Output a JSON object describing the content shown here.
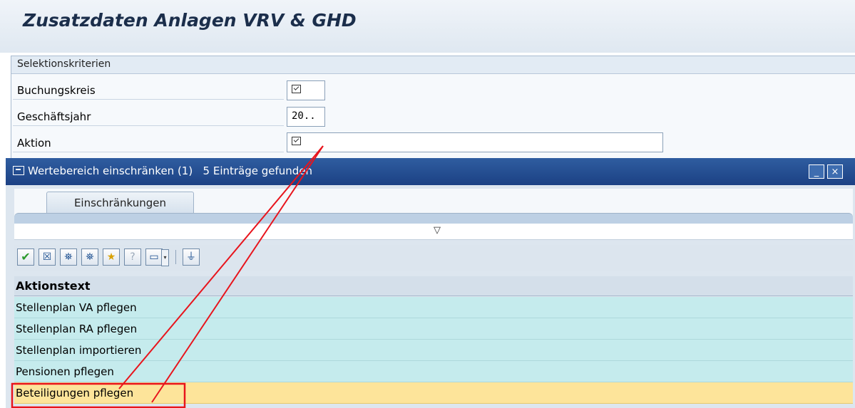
{
  "screen": {
    "title": "Zusatzdaten Anlagen VRV & GHD"
  },
  "selection": {
    "frame_title": "Selektionskriterien",
    "fields": [
      {
        "label": "Buchungskreis",
        "value": ""
      },
      {
        "label": "Geschäftsjahr",
        "value": "20.."
      },
      {
        "label": "Aktion",
        "value": ""
      }
    ]
  },
  "popup": {
    "title": "Wertebereich einschränken (1)",
    "found": "5 Einträge gefunden",
    "minimize_label": "_",
    "close_label": "×",
    "tab_label": "Einschränkungen",
    "collapse_glyph": "▽",
    "toolbar": [
      {
        "icon": "checkmark-icon",
        "glyph": "✔"
      },
      {
        "icon": "cancel-icon",
        "glyph": "☒"
      },
      {
        "icon": "binoculars-icon",
        "glyph": "⛯"
      },
      {
        "icon": "find-next-icon",
        "glyph": "⛯"
      },
      {
        "icon": "favorite-add-icon",
        "glyph": "★"
      },
      {
        "icon": "help-icon",
        "glyph": "?"
      },
      {
        "icon": "print-icon",
        "glyph": "▭"
      },
      {
        "icon": "filter-icon",
        "glyph": "⏚"
      }
    ],
    "column_header": "Aktionstext",
    "rows": [
      "Stellenplan VA pflegen",
      "Stellenplan RA pflegen",
      "Stellenplan importieren",
      "Pensionen pflegen",
      "Beteiligungen pflegen"
    ],
    "selected_row_index": 4
  },
  "colors": {
    "accent": "#1c4184",
    "row_bg": "#c5ebed",
    "selected_row": "#fde49a",
    "annotation": "#e8141c"
  }
}
